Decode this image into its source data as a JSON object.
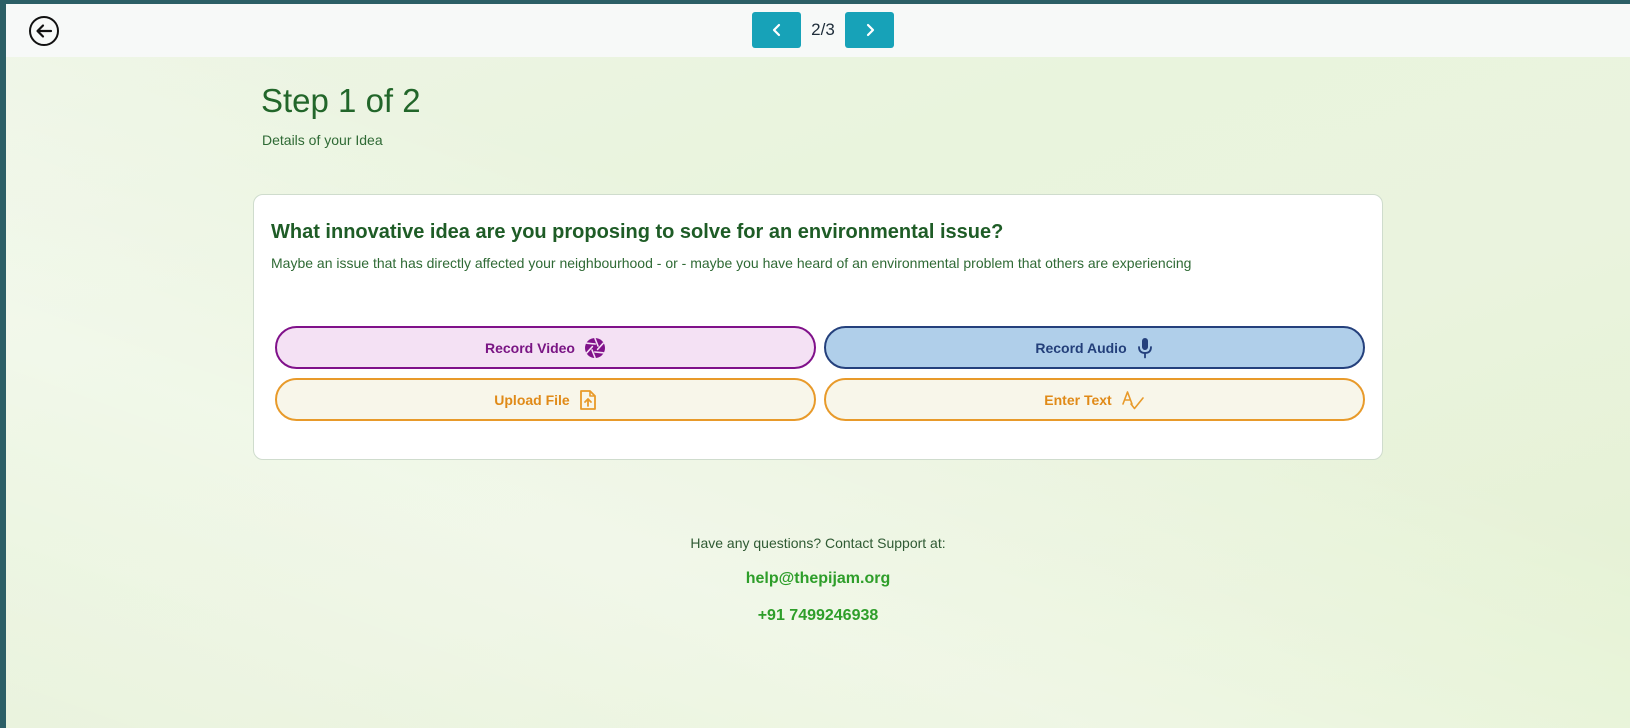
{
  "header": {
    "back_icon": "arrow-left-circle-icon",
    "pager": {
      "prev_icon": "chevron-left-icon",
      "next_icon": "chevron-right-icon",
      "count": "2/3",
      "button_color": "#17a2b8"
    }
  },
  "step": {
    "title": "Step 1 of 2",
    "subtitle": "Details of your Idea"
  },
  "question": {
    "title": "What innovative idea are you proposing to solve for an environmental issue?",
    "description": "Maybe an issue that has directly affected your neighbourhood - or - maybe you have heard of an environmental problem that others are experiencing"
  },
  "options": {
    "record_video": {
      "label": "Record Video",
      "icon": "camera-aperture-icon",
      "color": "#80118a"
    },
    "record_audio": {
      "label": "Record Audio",
      "icon": "microphone-icon",
      "color": "#24407c"
    },
    "upload_file": {
      "label": "Upload File",
      "icon": "file-upload-icon",
      "color": "#e89a2a"
    },
    "enter_text": {
      "label": "Enter Text",
      "icon": "text-check-icon",
      "color": "#e89a2a"
    }
  },
  "support": {
    "text": "Have any questions? Contact Support at:",
    "email": "help@thepijam.org",
    "phone": "+91 7499246938"
  }
}
